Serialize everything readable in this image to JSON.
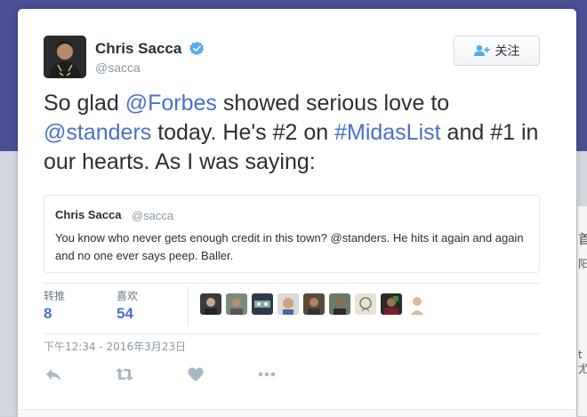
{
  "author": {
    "name": "Chris Sacca",
    "handle": "@sacca"
  },
  "follow_button": {
    "label": "关注"
  },
  "tweet": {
    "part1": "So glad ",
    "mention_forbes": "@Forbes",
    "part2": " showed serious love to ",
    "mention_standers": "@standers",
    "part3": " today. He's #2 on ",
    "hashtag": "#MidasList",
    "part4": " and #1 in our hearts. As I was saying:"
  },
  "quoted_tweet": {
    "name": "Chris Sacca",
    "handle": "@sacca",
    "text": "You know who never gets enough credit in this town? @standers. He hits it again and again and no one ever says peep. Baller."
  },
  "stats": {
    "retweets_label": "转推",
    "retweets_value": "8",
    "likes_label": "喜欢",
    "likes_value": "54"
  },
  "liker_avatar_count": 9,
  "timestamp": "下午12:34 - 2016年3月23日",
  "actions": [
    "reply-icon",
    "retweet-icon",
    "like-icon",
    "more-icon"
  ],
  "background_fragments": {
    "line1": "首",
    "line2": "阳",
    "line3": "t 尤"
  },
  "colors": {
    "link": "#4a6fce",
    "text": "#292f33",
    "muted": "#8899a6",
    "verified": "#55acee",
    "header_bg": "#4b4f93"
  }
}
